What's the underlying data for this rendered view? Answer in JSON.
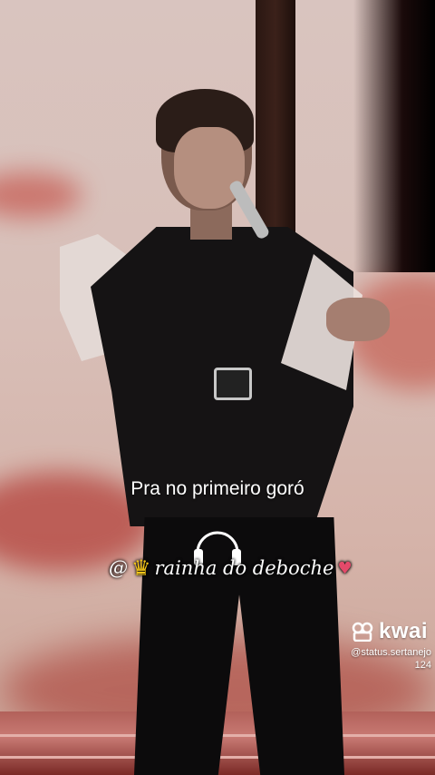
{
  "caption": "Pra no primeiro goró",
  "signature": {
    "prefix": "@",
    "crown_icon": "crown-emoji",
    "name": "rainha do deboche",
    "lips_icon": "lips-emoji",
    "accent_color": "#f2c418"
  },
  "watermark": {
    "brand": "kwai",
    "handle_line1": "@status.sertanejo",
    "handle_line2": "124"
  }
}
